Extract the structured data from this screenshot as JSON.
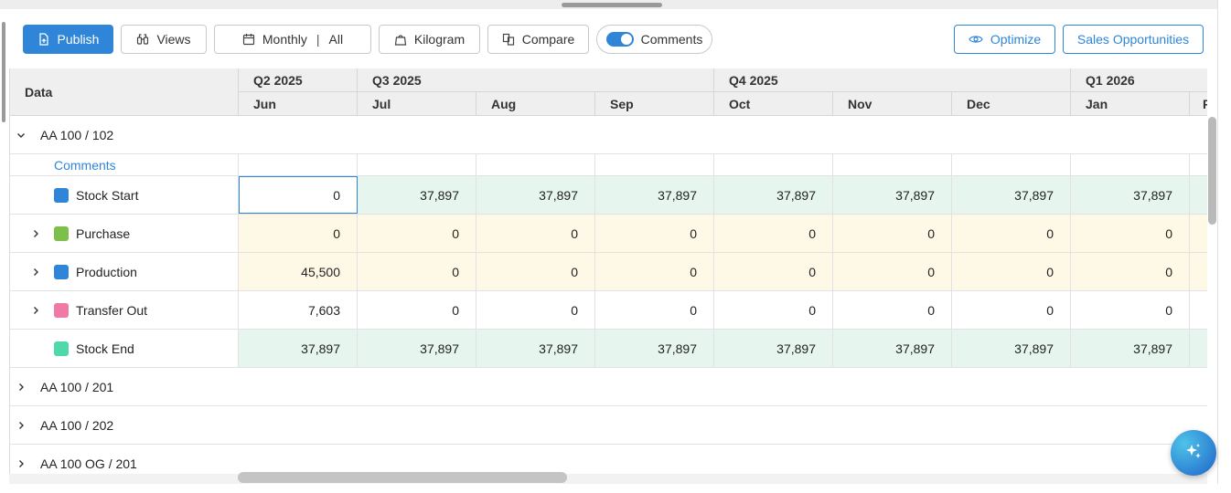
{
  "toolbar": {
    "publish_label": "Publish",
    "views_label": "Views",
    "period_label": "Monthly",
    "period_sep": "|",
    "period_scope": "All",
    "unit_label": "Kilogram",
    "compare_label": "Compare",
    "comments_toggle_label": "Comments",
    "comments_toggle_on": true,
    "optimize_label": "Optimize",
    "sales_label": "Sales Opportunities"
  },
  "header": {
    "data_label": "Data",
    "quarters": [
      "Q2 2025",
      "Q3 2025",
      "Q4 2025",
      "Q1 2026"
    ],
    "months": [
      "Jun",
      "Jul",
      "Aug",
      "Sep",
      "Oct",
      "Nov",
      "Dec",
      "Jan",
      "Fe"
    ]
  },
  "groups": [
    {
      "label": "AA 100 / 102",
      "expanded": true
    },
    {
      "label": "AA 100 / 201",
      "expanded": false
    },
    {
      "label": "AA 100 / 202",
      "expanded": false
    },
    {
      "label": "AA 100 OG / 201",
      "expanded": false
    }
  ],
  "comments_label": "Comments",
  "rows": [
    {
      "label": "Stock Start",
      "color": "#2f86d8",
      "values": [
        "0",
        "37,897",
        "37,897",
        "37,897",
        "37,897",
        "37,897",
        "37,897",
        "37,897"
      ]
    },
    {
      "label": "Purchase",
      "color": "#7cc04b",
      "values": [
        "0",
        "0",
        "0",
        "0",
        "0",
        "0",
        "0",
        "0"
      ]
    },
    {
      "label": "Production",
      "color": "#2f86d8",
      "values": [
        "45,500",
        "0",
        "0",
        "0",
        "0",
        "0",
        "0",
        "0"
      ]
    },
    {
      "label": "Transfer Out",
      "color": "#f07aa6",
      "values": [
        "7,603",
        "0",
        "0",
        "0",
        "0",
        "0",
        "0",
        "0"
      ]
    },
    {
      "label": "Stock End",
      "color": "#4fd9a8",
      "values": [
        "37,897",
        "37,897",
        "37,897",
        "37,897",
        "37,897",
        "37,897",
        "37,897",
        "37,897"
      ]
    }
  ],
  "colors": {
    "accent": "#2f86d8",
    "stock_bg": "#e6f6ee",
    "flow_bg": "#fdf9e6"
  },
  "icons": [
    "publish-icon",
    "views-icon",
    "calendar-icon",
    "kilogram-icon",
    "compare-icon",
    "optimize-icon",
    "chevron-down-icon",
    "chevron-right-icon",
    "ai-sparkle-icon"
  ]
}
